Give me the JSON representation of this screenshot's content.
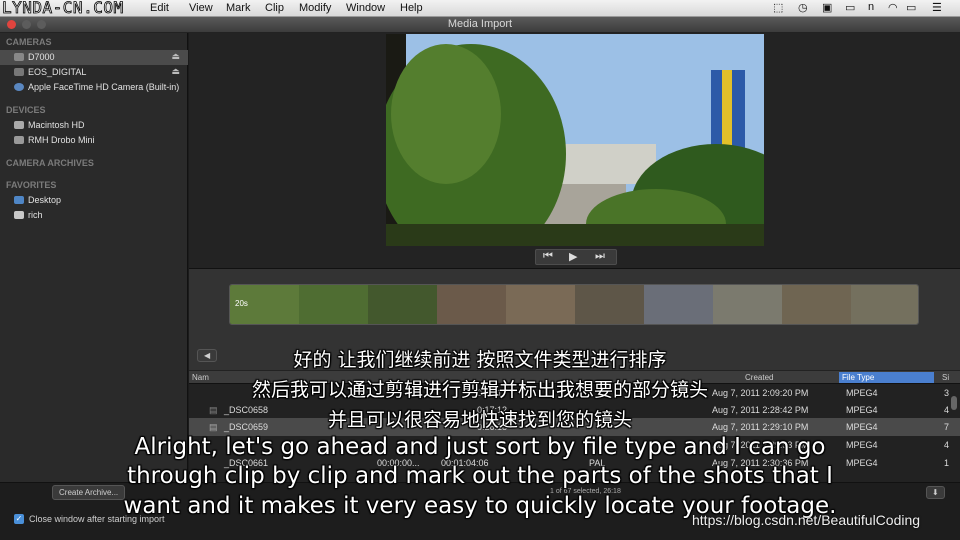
{
  "watermark": "LYNDA-CN.COM",
  "menu": [
    "Edit",
    "View",
    "Mark",
    "Clip",
    "Modify",
    "Window",
    "Help"
  ],
  "window": {
    "title": "Media Import"
  },
  "sidebar": {
    "cameras_header": "CAMERAS",
    "cameras": [
      {
        "label": "D7000"
      },
      {
        "label": "EOS_DIGITAL"
      },
      {
        "label": "Apple FaceTime HD Camera (Built-in)"
      }
    ],
    "devices_header": "DEVICES",
    "devices": [
      {
        "label": "Macintosh HD"
      },
      {
        "label": "RMH Drobo Mini"
      }
    ],
    "archives_header": "CAMERA ARCHIVES",
    "favorites_header": "FAVORITES",
    "favorites": [
      {
        "label": "Desktop"
      },
      {
        "label": "rich"
      }
    ]
  },
  "filmstrip": {
    "duration_label": "20s"
  },
  "table": {
    "headers": {
      "name": "Nam",
      "created": "Created",
      "file_type": "File Type",
      "size": "Si"
    },
    "rows": [
      {
        "name": "",
        "start": "",
        "end": "0:09:17",
        "created": "Aug 7, 2011 2:09:20 PM",
        "type": "MPEG4",
        "size": "3"
      },
      {
        "name": "_DSC0658",
        "start": "",
        "end": "0:17:12",
        "created": "Aug 7, 2011 2:28:42 PM",
        "type": "MPEG4",
        "size": "4"
      },
      {
        "name": "_DSC0659",
        "start": "",
        "end": "0:26:18",
        "created": "Aug 7, 2011 2:29:10 PM",
        "type": "MPEG4",
        "size": "7"
      },
      {
        "name": "",
        "start": "",
        "end": "",
        "created": "Aug 7, 2011 2:29:53 PM",
        "type": "MPEG4",
        "size": "4"
      },
      {
        "name": "_DSC0661",
        "start": "00:00:00...",
        "end": "00:01:04:06",
        "created": "Aug 7, 2011 2:30:36 PM",
        "type": "MPEG4",
        "size": "1"
      }
    ],
    "format": "PAL",
    "selection_status": "1 of 67 selected, 26:18"
  },
  "bottom": {
    "create_archive": "Create Archive...",
    "close_window": "Close window after starting import"
  },
  "subtitles": {
    "zh": [
      "好的 让我们继续前进 按照文件类型进行排序",
      "然后我可以通过剪辑进行剪辑并标出我想要的部分镜头",
      "并且可以很容易地快速找到您的镜头"
    ],
    "en": [
      "Alright, let's go ahead and just sort by file type and I can go",
      "through clip by clip and mark out the parts of the shots that I",
      "want and it makes it very easy to quickly locate your footage."
    ]
  },
  "csdn_watermark": "https://blog.csdn.net/BeautifulCoding",
  "colors": {
    "accent": "#4a90d9",
    "sidebar": "#2a2a2a",
    "panel": "#232323"
  }
}
